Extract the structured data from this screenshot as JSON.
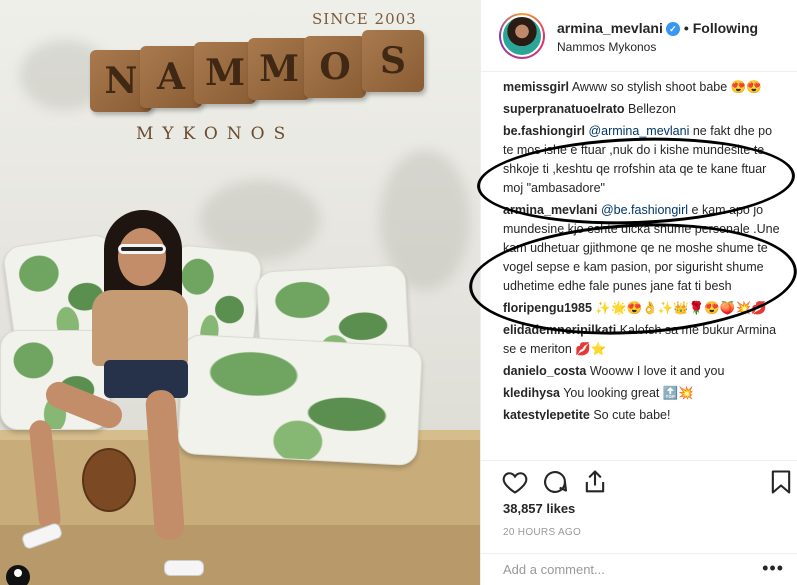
{
  "post": {
    "username": "armina_mevlani",
    "verified_icon": "verified-badge-icon",
    "follow_state": "Following",
    "separator": "•",
    "location": "Nammos Mykonos"
  },
  "photo": {
    "sign_since": "SINCE 2003",
    "sign_letters": [
      "N",
      "A",
      "M",
      "M",
      "O",
      "S"
    ],
    "sign_subtitle": "MYKONOS"
  },
  "comments": [
    {
      "user": "memissgirl",
      "text": "Awww so stylish shoot babe 😍😍"
    },
    {
      "user": "superpranatuoelrato",
      "text": "Bellezon"
    },
    {
      "user": "be.fashiongirl",
      "mention": "@armina_mevlani",
      "text": "ne fakt dhe po te mos ishe e ftuar ,nuk do i kishe mundesite te shkoje ti ,keshtu qe rrofshin ata qe te kane ftuar moj \"ambasadore\""
    },
    {
      "user": "armina_mevlani",
      "mention": "@be.fashiongirl",
      "text": "e kam apo jo mundesine kjo eshte dicka shume personale .Une kam udhetuar gjithmone qe ne moshe shume te vogel sepse e kam pasion, por sigurisht shume udhetime edhe fale punes jane fat ti besh"
    },
    {
      "user": "floripengu1985",
      "text": "✨🌟😍👌✨👑🌹😍🍑💥💋"
    },
    {
      "user": "elidademneripilkati",
      "text": "Kalofsh sa me bukur Armina se e meriton 💋⭐"
    },
    {
      "user": "danielo_costa",
      "text": "Wooww I love it and you"
    },
    {
      "user": "kledihysa",
      "text": "You looking great 🔝💥"
    },
    {
      "user": "katestylepetite",
      "text": "So cute babe!"
    }
  ],
  "actions": {
    "like_icon": "heart-icon",
    "comment_icon": "comment-icon",
    "share_icon": "share-icon",
    "save_icon": "bookmark-icon"
  },
  "likes": "38,857 likes",
  "timestamp": "20 HOURS AGO",
  "add_comment": {
    "placeholder": "Add a comment...",
    "more": "•••"
  }
}
